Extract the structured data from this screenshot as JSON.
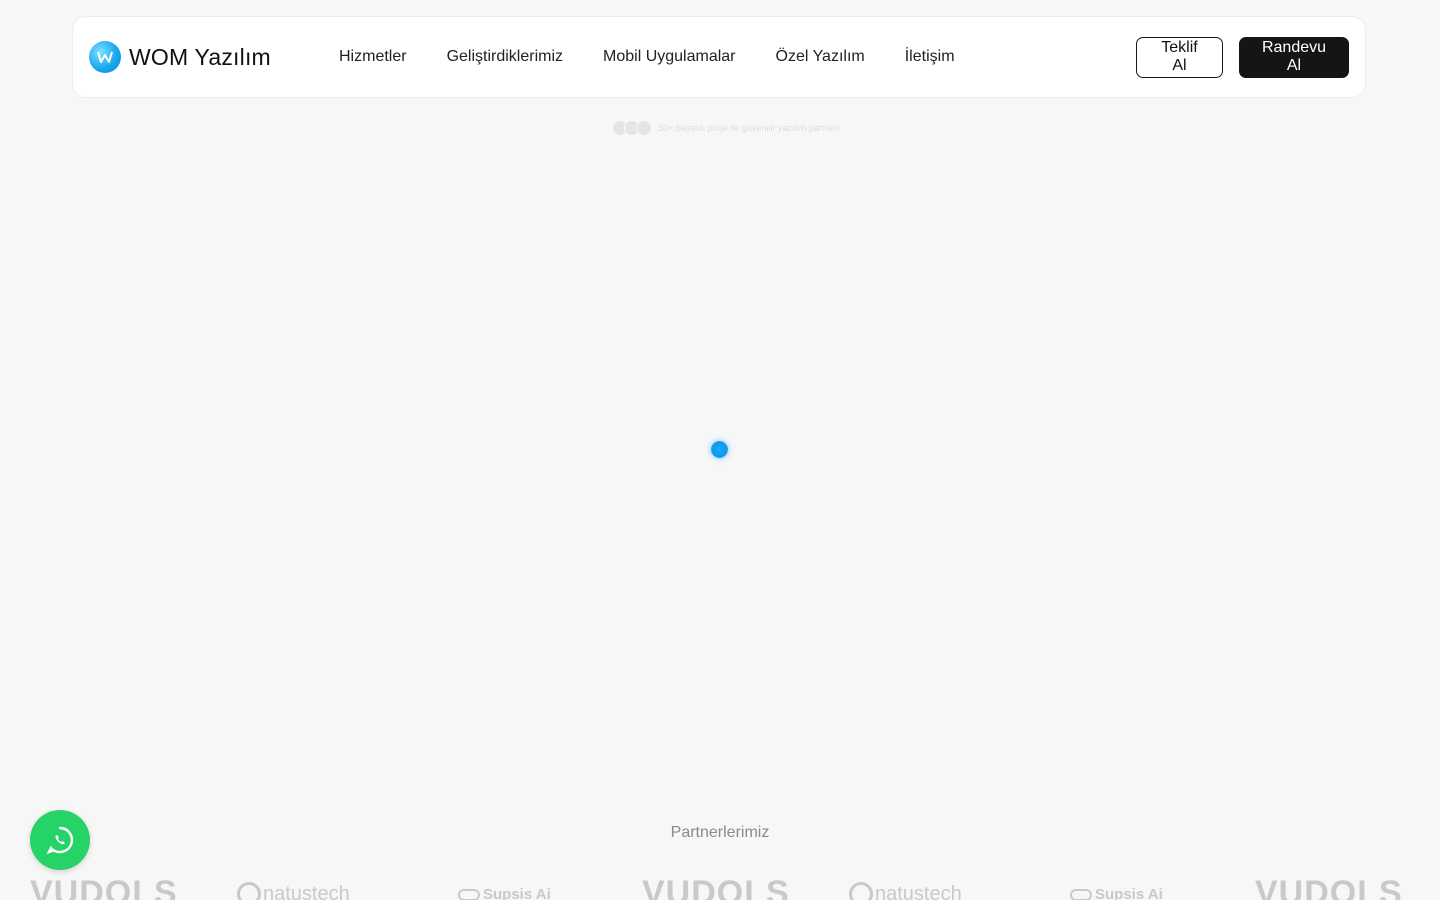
{
  "brand": {
    "name": "WOM Yazılım",
    "logo_icon": "wom-logo-icon",
    "accent": "#1aa8f0"
  },
  "nav": {
    "items": [
      {
        "label": "Hizmetler"
      },
      {
        "label": "Geliştirdiklerimiz"
      },
      {
        "label": "Mobil Uygulamalar"
      },
      {
        "label": "Özel Yazılım"
      },
      {
        "label": "İletişim"
      }
    ]
  },
  "actions": {
    "quote_label": "Teklif Al",
    "appointment_label": "Randevu Al"
  },
  "hero": {
    "tagline": "50+ başarılı proje ile güvenilir yazılım partneri"
  },
  "partners": {
    "title": "Partnerlerimiz",
    "logos": [
      "VUDOLS",
      "natustech",
      "Supsis Ai",
      "VUDOLS",
      "natustech",
      "Supsis Ai",
      "VUDOLS"
    ]
  },
  "floating": {
    "whatsapp_icon": "whatsapp-icon",
    "whatsapp_color": "#25d366"
  }
}
